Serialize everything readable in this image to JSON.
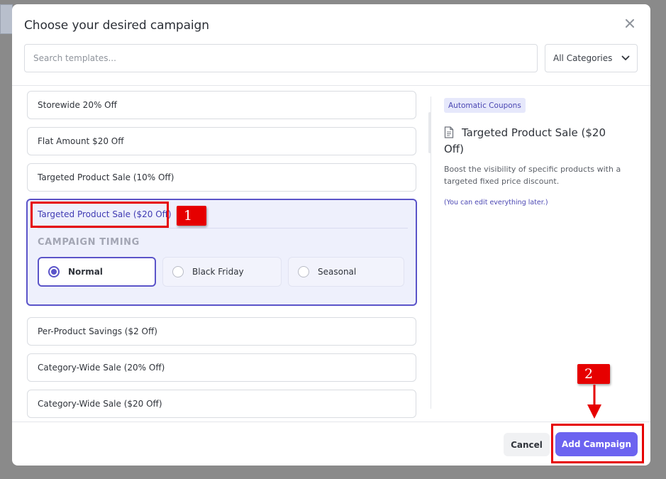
{
  "modal": {
    "title": "Choose your desired campaign",
    "search_placeholder": "Search templates...",
    "category_select": "All Categories"
  },
  "templates": [
    {
      "label": "Storewide 20% Off"
    },
    {
      "label": "Flat Amount $20 Off"
    },
    {
      "label": "Targeted Product Sale (10% Off)"
    },
    {
      "label": "Targeted Product Sale ($20 Off)",
      "selected": true
    },
    {
      "label": "Per-Product Savings ($2 Off)"
    },
    {
      "label": "Category-Wide Sale (20% Off)"
    },
    {
      "label": "Category-Wide Sale ($20 Off)"
    }
  ],
  "timing": {
    "heading": "CAMPAIGN TIMING",
    "options": [
      {
        "label": "Normal",
        "selected": true
      },
      {
        "label": "Black Friday",
        "selected": false
      },
      {
        "label": "Seasonal",
        "selected": false
      }
    ]
  },
  "preview": {
    "badge": "Automatic Coupons",
    "title": "Targeted Product Sale ($20 Off)",
    "description": "Boost the visibility of specific products with a targeted fixed price discount.",
    "note": "(You can edit everything later.)"
  },
  "footer": {
    "cancel_label": "Cancel",
    "add_label": "Add Campaign"
  },
  "annotations": {
    "step1": "1",
    "step2": "2"
  },
  "colors": {
    "accent": "#5b54c9",
    "primary_button": "#6c63f0",
    "annotation_red": "#e60000"
  }
}
